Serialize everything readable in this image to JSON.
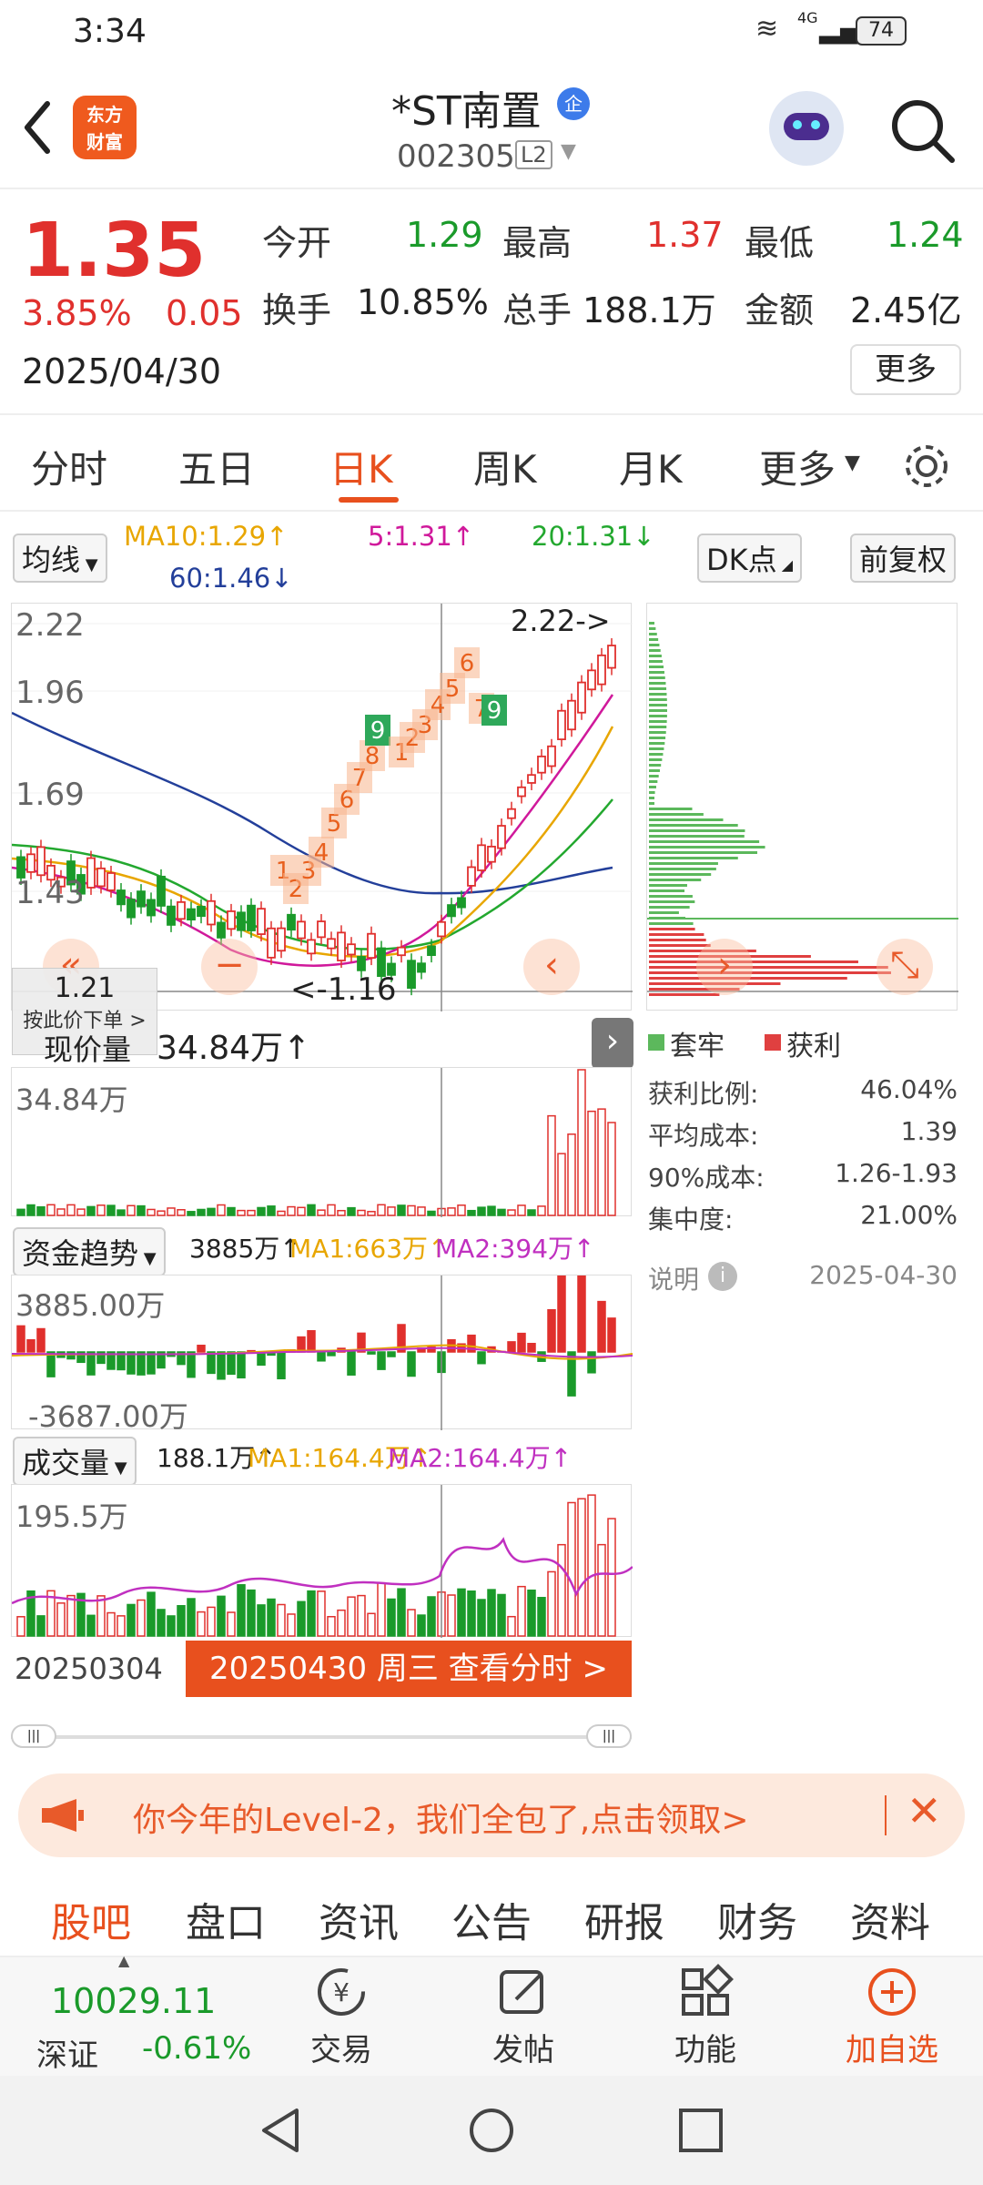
{
  "status_bar": {
    "time": "3:34",
    "network": "4G",
    "battery": "74"
  },
  "header": {
    "logo_line1": "东方",
    "logo_line2": "财富",
    "title": "*ST南置",
    "title_badge": "企",
    "code": "002305",
    "level_badge": "L2"
  },
  "quote": {
    "price": "1.35",
    "change_pct": "3.85%",
    "change_abs": "0.05",
    "date": "2025/04/30",
    "open_label": "今开",
    "open": "1.29",
    "high_label": "最高",
    "high": "1.37",
    "low_label": "最低",
    "low": "1.24",
    "turnover_label": "换手",
    "turnover": "10.85%",
    "volume_label": "总手",
    "volume": "188.1万",
    "amount_label": "金额",
    "amount": "2.45亿",
    "more_button": "更多"
  },
  "tabs": [
    "分时",
    "五日",
    "日K",
    "周K",
    "月K",
    "更多"
  ],
  "active_tab": "日K",
  "chart_toolbar": {
    "indicator": "均线",
    "ma10": "MA10:1.29↑",
    "ma5": "5:1.31↑",
    "ma20": "20:1.31↓",
    "ma60": "60:1.46↓",
    "dk_button": "DK点",
    "fq_button": "前复权"
  },
  "kline": {
    "y_labels": [
      "2.22",
      "1.96",
      "1.69",
      "1.43"
    ],
    "high_marker": "2.22->",
    "low_marker": "<-1.16",
    "cursor_price": "1.21",
    "cursor_hint": "按此价下单 >",
    "tags": [
      "1",
      "2",
      "3",
      "4",
      "5",
      "6",
      "7",
      "8",
      "9",
      "1",
      "2",
      "3",
      "4",
      "5",
      "6",
      "7",
      "9"
    ],
    "colors": {
      "up": "#e0302d",
      "down": "#1a9a2a",
      "ma5": "#d0199b",
      "ma10": "#e8a600",
      "ma20": "#23a82f",
      "ma60": "#233f9a"
    }
  },
  "volume_price": {
    "label": "现价量",
    "value": "34.84万↑",
    "axis_label": "34.84万"
  },
  "chips": {
    "legend_trapped": "套牢",
    "legend_profit": "获利",
    "rows": [
      {
        "label": "获利比例:",
        "value": "46.04%"
      },
      {
        "label": "平均成本:",
        "value": "1.39"
      },
      {
        "label": "90%成本:",
        "value": "1.26-1.93"
      },
      {
        "label": "集中度:",
        "value": "21.00%"
      }
    ],
    "note": "说明",
    "date": "2025-04-30"
  },
  "fund_flow": {
    "label": "资金趋势",
    "value": "3885万↑",
    "ma1": "MA1:663万↑",
    "ma2": "MA2:394万↑",
    "top": "3885.00万",
    "bottom": "-3687.00万"
  },
  "volume": {
    "label": "成交量",
    "value": "188.1万↑",
    "ma1": "MA1:164.4万↑",
    "ma2": "MA2:164.4万↑",
    "top": "195.5万"
  },
  "date_range": {
    "start": "20250304",
    "cursor_button": "20250430 周三 查看分时 >"
  },
  "banner": {
    "text": "你今年的Level-2，我们全包了,点击领取>"
  },
  "info_tabs": [
    "股吧",
    "盘口",
    "资讯",
    "公告",
    "研报",
    "财务",
    "资料"
  ],
  "active_info_tab": "股吧",
  "bottom_bar": {
    "index_value": "10029.11",
    "index_name": "深证",
    "index_change": "-0.61%",
    "trade": "交易",
    "post": "发帖",
    "functions": "功能",
    "add_watch": "加自选"
  }
}
